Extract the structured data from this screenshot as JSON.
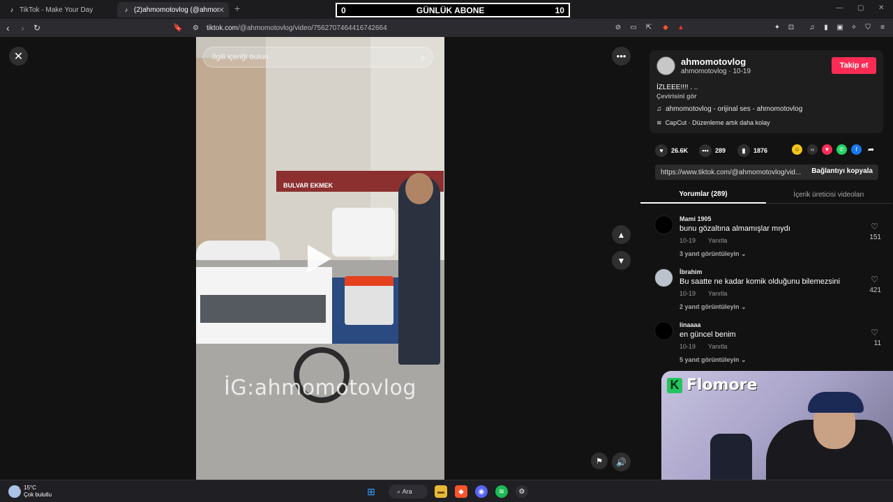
{
  "browser": {
    "tabs": [
      {
        "title": "TikTok - Make Your Day"
      },
      {
        "title": "(2)ahmomotovlog (@ahmomoto"
      }
    ],
    "new_tab_glyph": "+",
    "url_prefix": "tiktok.com",
    "url_path": "/@ahmomotovlog/video/7562707464416742664"
  },
  "overlay_counter": {
    "left_value": "0",
    "title": "GÜNLÜK ABONE",
    "right_value": "10"
  },
  "video": {
    "search_placeholder": "İlgili içeriği bulun",
    "watermark": "İG:ahmomotovlog",
    "shop_sign": "BULVAR EKMEK"
  },
  "post": {
    "author": "ahmomotovlog",
    "author_sub": "ahmomotovlog · 10-19",
    "follow_label": "Takip et",
    "caption": "İZLEEE!!!! . ..",
    "translate_label": "Çevirisini gör",
    "music": "ahmomotovlog - orijinal ses - ahmomotovlog",
    "capcut": "CapCut · Düzenleme artık daha kolay",
    "likes": "26.6K",
    "comments": "289",
    "saves": "1876",
    "link": "https://www.tiktok.com/@ahmomotovlog/vid...",
    "copy_label": "Bağlantıyı kopyala"
  },
  "tabs": {
    "comments_label": "Yorumlar (289)",
    "creator_label": "İçerik üreticisi videoları"
  },
  "comments": [
    {
      "user": "Mami 1905",
      "text": "bunu gözaltına almamışlar mıydı",
      "date": "10-19",
      "reply": "Yanıtla",
      "likes": "151",
      "more": "3 yanıt görüntüleyin ⌄"
    },
    {
      "user": "İbrahim",
      "text": "Bu saatte ne kadar komik olduğunu bilemezsini",
      "date": "10-19",
      "reply": "Yanıtla",
      "likes": "421",
      "more": "2 yanıt görüntüleyin ⌄"
    },
    {
      "user": "linaaaa",
      "text": "en güncel benim",
      "date": "10-19",
      "reply": "Yanıtla",
      "likes": "11",
      "more": "5 yanıt görüntüleyin ⌄"
    }
  ],
  "webcam": {
    "brand": "Flomore",
    "logo_letter": "K"
  },
  "taskbar": {
    "temperature": "15°C",
    "weather": "Çok bulutlu",
    "search_label": "Ara"
  },
  "colors": {
    "accent": "#fe2c55",
    "brand_green": "#22c55e"
  }
}
